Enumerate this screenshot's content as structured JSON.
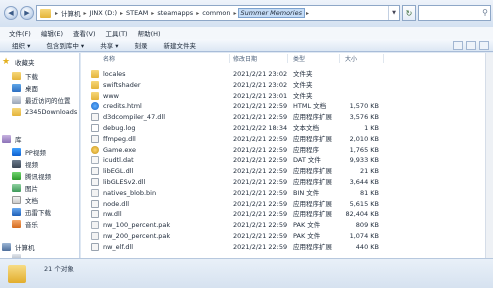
{
  "address": {
    "crumbs": [
      "计算机",
      "JINX (D:)",
      "STEAM",
      "steamapps",
      "common",
      "Summer Memories"
    ]
  },
  "menu": [
    "文件(F)",
    "编辑(E)",
    "查看(V)",
    "工具(T)",
    "帮助(H)"
  ],
  "commands": [
    "组织 ▾",
    "包含到库中 ▾",
    "共享 ▾",
    "刻录",
    "新建文件夹"
  ],
  "columns": [
    "名称",
    "修改日期",
    "类型",
    "大小"
  ],
  "sidebar": {
    "items": [
      {
        "label": "收藏夹",
        "icon": "star-icon"
      },
      {
        "label": "下载",
        "icon": "download-folder-icon"
      },
      {
        "label": "桌面",
        "icon": "desktop-icon"
      },
      {
        "label": "最近访问的位置",
        "icon": "recent-places-icon"
      },
      {
        "label": "2345Downloads",
        "icon": "folder-icon"
      },
      {
        "label": "库",
        "icon": "library-icon"
      },
      {
        "label": "PP视频",
        "icon": "pp-video-icon"
      },
      {
        "label": "视频",
        "icon": "video-icon"
      },
      {
        "label": "腾讯视频",
        "icon": "tencent-video-icon"
      },
      {
        "label": "图片",
        "icon": "pictures-icon"
      },
      {
        "label": "文档",
        "icon": "documents-icon"
      },
      {
        "label": "迅雷下载",
        "icon": "thunder-download-icon"
      },
      {
        "label": "音乐",
        "icon": "music-icon"
      },
      {
        "label": "计算机",
        "icon": "computer-icon"
      },
      {
        "label": "",
        "icon": "drive-icon"
      }
    ]
  },
  "files": [
    {
      "name": "locales",
      "date": "2021/2/21 23:02",
      "type": "文件夹",
      "size": "",
      "icon": "folder"
    },
    {
      "name": "swiftshader",
      "date": "2021/2/21 23:02",
      "type": "文件夹",
      "size": "",
      "icon": "folder"
    },
    {
      "name": "www",
      "date": "2021/2/21 23:01",
      "type": "文件夹",
      "size": "",
      "icon": "folder"
    },
    {
      "name": "credits.html",
      "date": "2021/2/21 22:59",
      "type": "HTML 文档",
      "size": "1,570 KB",
      "icon": "html"
    },
    {
      "name": "d3dcompiler_47.dll",
      "date": "2021/2/21 22:59",
      "type": "应用程序扩展",
      "size": "3,576 KB",
      "icon": "dll"
    },
    {
      "name": "debug.log",
      "date": "2021/2/22 18:34",
      "type": "文本文档",
      "size": "1 KB",
      "icon": "txt"
    },
    {
      "name": "ffmpeg.dll",
      "date": "2021/2/21 22:59",
      "type": "应用程序扩展",
      "size": "2,010 KB",
      "icon": "dll"
    },
    {
      "name": "Game.exe",
      "date": "2021/2/21 22:59",
      "type": "应用程序",
      "size": "1,765 KB",
      "icon": "game"
    },
    {
      "name": "icudtl.dat",
      "date": "2021/2/21 22:59",
      "type": "DAT 文件",
      "size": "9,933 KB",
      "icon": "dat"
    },
    {
      "name": "libEGL.dll",
      "date": "2021/2/21 22:59",
      "type": "应用程序扩展",
      "size": "21 KB",
      "icon": "dll"
    },
    {
      "name": "libGLESv2.dll",
      "date": "2021/2/21 22:59",
      "type": "应用程序扩展",
      "size": "3,644 KB",
      "icon": "dll"
    },
    {
      "name": "natives_blob.bin",
      "date": "2021/2/21 22:59",
      "type": "BIN 文件",
      "size": "81 KB",
      "icon": "bin"
    },
    {
      "name": "node.dll",
      "date": "2021/2/21 22:59",
      "type": "应用程序扩展",
      "size": "5,615 KB",
      "icon": "dll"
    },
    {
      "name": "nw.dll",
      "date": "2021/2/21 22:59",
      "type": "应用程序扩展",
      "size": "82,404 KB",
      "icon": "dll"
    },
    {
      "name": "nw_100_percent.pak",
      "date": "2021/2/21 22:59",
      "type": "PAK 文件",
      "size": "809 KB",
      "icon": "pak"
    },
    {
      "name": "nw_200_percent.pak",
      "date": "2021/2/21 22:59",
      "type": "PAK 文件",
      "size": "1,074 KB",
      "icon": "pak"
    },
    {
      "name": "nw_elf.dll",
      "date": "2021/2/21 22:59",
      "type": "应用程序扩展",
      "size": "440 KB",
      "icon": "dll"
    }
  ],
  "status": {
    "count": "21 个对象"
  }
}
